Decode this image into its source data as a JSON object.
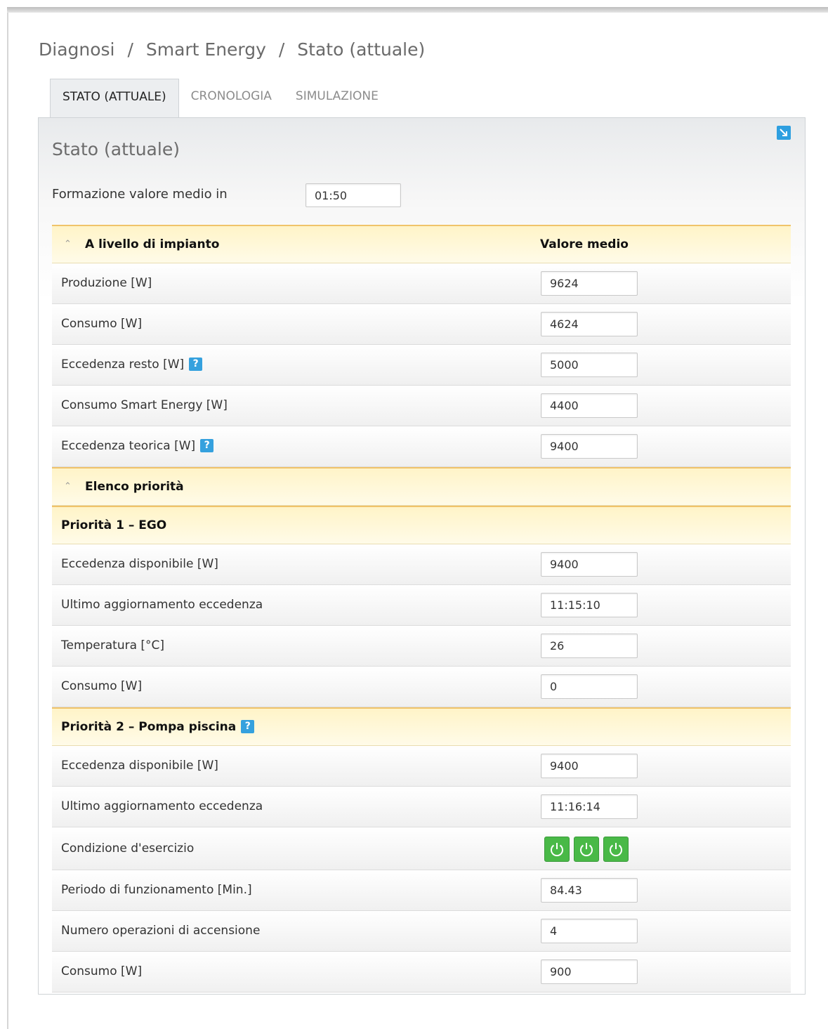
{
  "breadcrumb": [
    "Diagnosi",
    "Smart Energy",
    "Stato (attuale)"
  ],
  "breadcrumb_sep": "/",
  "tabs": [
    {
      "label": "STATO (ATTUALE)",
      "active": true
    },
    {
      "label": "CRONOLOGIA",
      "active": false
    },
    {
      "label": "SIMULAZIONE",
      "active": false
    }
  ],
  "panel": {
    "title": "Stato (attuale)",
    "avg_label": "Formazione valore medio in",
    "avg_value": "01:50"
  },
  "plant": {
    "header": "A livello di impianto",
    "column_header": "Valore medio",
    "rows": [
      {
        "label": "Produzione [W]",
        "value": "9624"
      },
      {
        "label": "Consumo [W]",
        "value": "4624"
      },
      {
        "label": "Eccedenza resto [W]",
        "value": "5000",
        "help": "?"
      },
      {
        "label": "Consumo Smart Energy [W]",
        "value": "4400"
      },
      {
        "label": "Eccedenza teorica [W]",
        "value": "9400",
        "help": "?"
      }
    ]
  },
  "priorities": {
    "header": "Elenco priorità",
    "p1": {
      "title": "Priorità 1 – EGO",
      "rows": [
        {
          "label": "Eccedenza disponibile [W]",
          "value": "9400"
        },
        {
          "label": "Ultimo aggiornamento eccedenza",
          "value": "11:15:10"
        },
        {
          "label": "Temperatura [°C]",
          "value": "26"
        },
        {
          "label": "Consumo [W]",
          "value": "0"
        }
      ]
    },
    "p2": {
      "title": "Priorità 2 – Pompa piscina",
      "help": "?",
      "rows": [
        {
          "label": "Eccedenza disponibile [W]",
          "value": "9400"
        },
        {
          "label": "Ultimo aggiornamento eccedenza",
          "value": "11:16:14"
        },
        {
          "label": "Condizione d'esercizio",
          "status_icons": [
            "power-icon",
            "power-icon",
            "power-icon"
          ],
          "status_color": "#49b947"
        },
        {
          "label": "Periodo di funzionamento [Min.]",
          "value": "84.43"
        },
        {
          "label": "Numero operazioni di accensione",
          "value": "4"
        },
        {
          "label": "Consumo [W]",
          "value": "900"
        }
      ]
    }
  },
  "colors": {
    "section_header_bg": "#fff4c8",
    "section_header_border": "#f0c36a",
    "help_icon": "#35a1de",
    "status_on": "#49b947"
  }
}
